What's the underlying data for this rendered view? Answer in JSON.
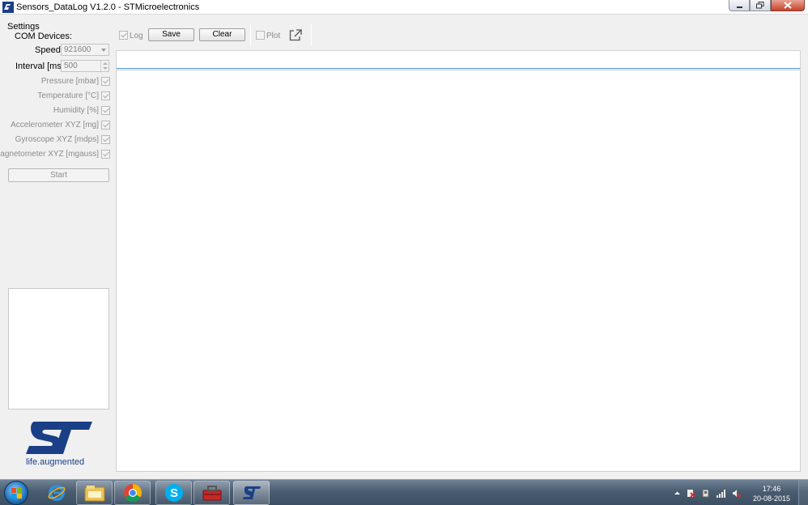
{
  "window": {
    "title": "Sensors_DataLog V1.2.0 - STMicroelectronics"
  },
  "settings": {
    "section_title": "Settings",
    "com_devices_label": "COM Devices:",
    "speed_label": "Speed:",
    "speed_value": "921600",
    "interval_label": "Interval [ms]:",
    "interval_value": "500",
    "sensors": [
      {
        "label": "Pressure  [mbar]",
        "checked": true
      },
      {
        "label": "Temperature  [°C]",
        "checked": true
      },
      {
        "label": "Humidity  [%]",
        "checked": true
      },
      {
        "label": "Accelerometer XYZ  [mg]",
        "checked": true
      },
      {
        "label": "Gyroscope XYZ  [mdps]",
        "checked": true
      },
      {
        "label": "Magnetometer XYZ [mgauss]",
        "checked": true
      }
    ],
    "start_label": "Start"
  },
  "toolbar": {
    "log_label": "Log",
    "log_checked": true,
    "save_label": "Save",
    "clear_label": "Clear",
    "plot_label": "Plot",
    "plot_checked": false
  },
  "logo": {
    "tagline": "life.augmented",
    "brand_color": "#1a3f86",
    "accent_color": "#3aa7d9"
  },
  "taskbar": {
    "apps": [
      "internet-explorer-icon",
      "file-explorer-icon",
      "chrome-icon",
      "skype-icon",
      "toolbox-icon",
      "st-app-icon"
    ],
    "time": "17:46",
    "date": "20-08-2015"
  }
}
